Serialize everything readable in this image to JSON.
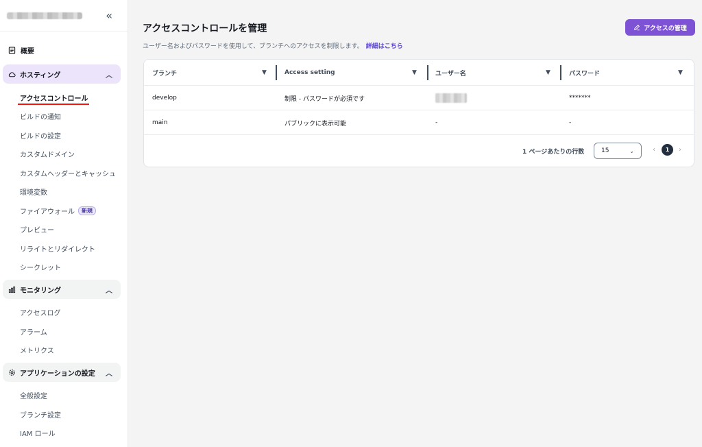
{
  "sidebar": {
    "collapse_glyph": "«",
    "overview_label": "概要",
    "hosting": {
      "label": "ホスティング",
      "items": [
        {
          "label": "アクセスコントロール"
        },
        {
          "label": "ビルドの通知"
        },
        {
          "label": "ビルドの設定"
        },
        {
          "label": "カスタムドメイン"
        },
        {
          "label": "カスタムヘッダーとキャッシュ"
        },
        {
          "label": "環境変数"
        },
        {
          "label": "ファイアウォール",
          "badge": "新規"
        },
        {
          "label": "プレビュー"
        },
        {
          "label": "リライトとリダイレクト"
        },
        {
          "label": "シークレット"
        }
      ]
    },
    "monitoring": {
      "label": "モニタリング",
      "items": [
        {
          "label": "アクセスログ"
        },
        {
          "label": "アラーム"
        },
        {
          "label": "メトリクス"
        }
      ]
    },
    "app_settings": {
      "label": "アプリケーションの設定",
      "items": [
        {
          "label": "全般設定"
        },
        {
          "label": "ブランチ設定"
        },
        {
          "label": "IAM ロール"
        }
      ]
    }
  },
  "main": {
    "title": "アクセスコントロールを管理",
    "description": "ユーザー名およびパスワードを使用して、ブランチへのアクセスを制限します。",
    "details_link": "詳細はこちら",
    "manage_button": "アクセスの管理"
  },
  "table": {
    "headers": [
      "ブランチ",
      "Access setting",
      "ユーザー名",
      "パスワード"
    ],
    "rows": [
      {
        "branch": "develop",
        "access": "制限 - パスワードが必須です",
        "username": "",
        "password": "*******"
      },
      {
        "branch": "main",
        "access": "パブリックに表示可能",
        "username": "-",
        "password": "-"
      }
    ]
  },
  "pagination": {
    "rows_label": "1 ページあたりの行数",
    "rows_value": "15",
    "current_page": "1"
  },
  "colors": {
    "accent": "#7d52d4",
    "active_section_bg": "#ebe4fb",
    "link": "#5b45d6",
    "active_underline": "#e8190f"
  }
}
